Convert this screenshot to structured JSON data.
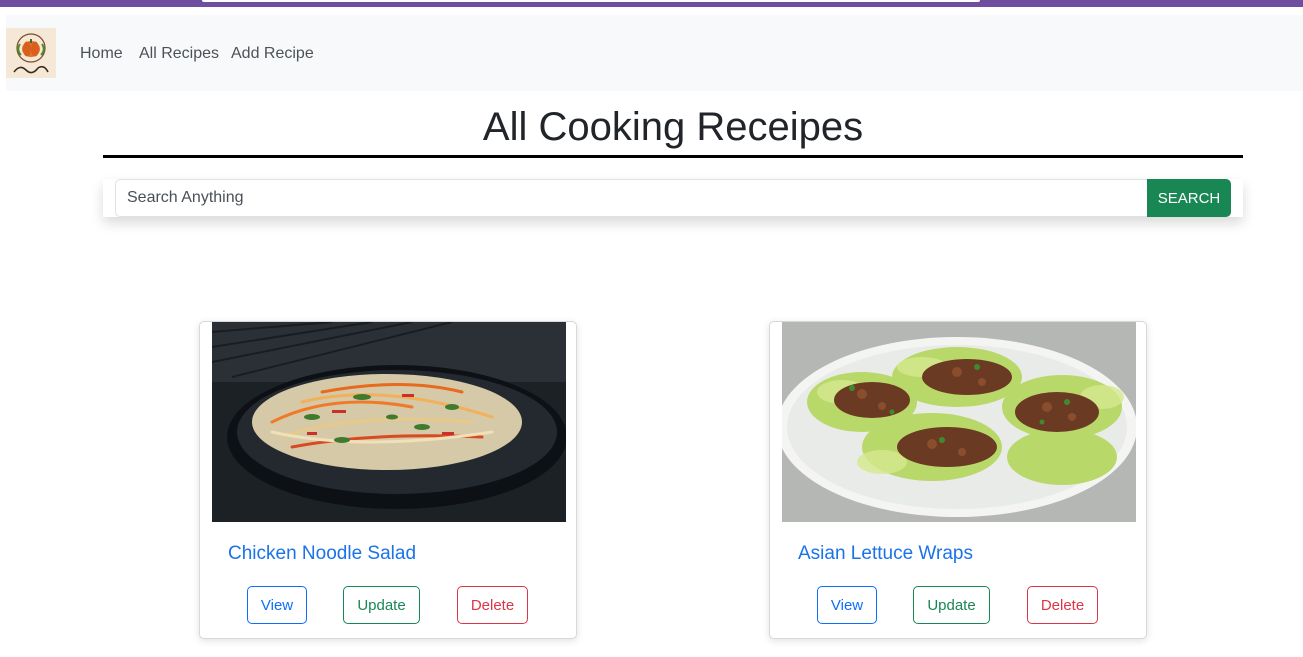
{
  "nav": {
    "links": [
      "Home",
      "All Recipes",
      "Add Recipe"
    ]
  },
  "main": {
    "title": "All Cooking Receipes",
    "search": {
      "placeholder": "Search Anything",
      "button_label": "SEARCH"
    }
  },
  "recipes": [
    {
      "title": "Chicken Noodle Salad",
      "actions": [
        "View",
        "Update",
        "Delete"
      ]
    },
    {
      "title": "Asian Lettuce Wraps",
      "actions": [
        "View",
        "Update",
        "Delete"
      ]
    }
  ],
  "colors": {
    "primary": "#0d6efd",
    "success": "#198754",
    "danger": "#dc3545",
    "navbar_bg": "#f8f9fa"
  }
}
